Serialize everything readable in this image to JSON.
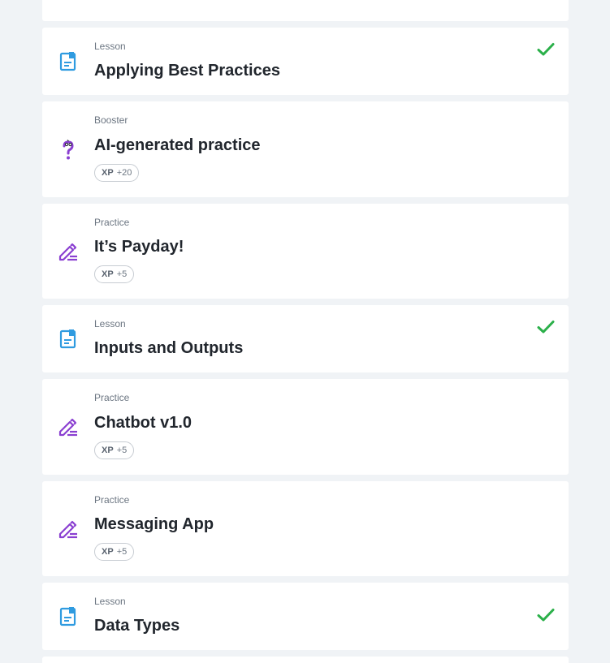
{
  "items": [
    {
      "kind": "Lesson",
      "title": "Applying Best Practices",
      "completed": true,
      "icon": "lesson-icon"
    },
    {
      "kind": "Booster",
      "title": "AI-generated practice",
      "xp_label": "XP",
      "xp_value": "+20",
      "icon": "booster-question-icon"
    },
    {
      "kind": "Practice",
      "title": "It’s Payday!",
      "xp_label": "XP",
      "xp_value": "+5",
      "icon": "practice-pencil-icon"
    },
    {
      "kind": "Lesson",
      "title": "Inputs and Outputs",
      "completed": true,
      "icon": "lesson-icon"
    },
    {
      "kind": "Practice",
      "title": "Chatbot v1.0",
      "xp_label": "XP",
      "xp_value": "+5",
      "icon": "practice-pencil-icon"
    },
    {
      "kind": "Practice",
      "title": "Messaging App",
      "xp_label": "XP",
      "xp_value": "+5",
      "icon": "practice-pencil-icon"
    },
    {
      "kind": "Lesson",
      "title": "Data Types",
      "completed": true,
      "icon": "lesson-icon"
    }
  ],
  "colors": {
    "lesson_icon": "#2f9be0",
    "practice_icon": "#8a3fd1",
    "check": "#2bb04a",
    "background": "#f0f3f6"
  }
}
